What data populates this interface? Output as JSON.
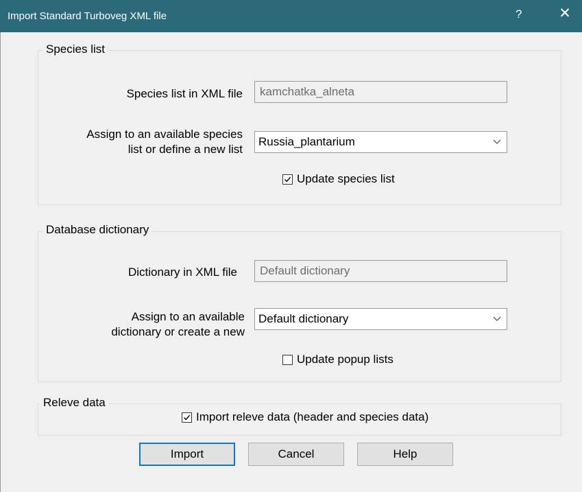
{
  "window": {
    "title": "Import Standard Turboveg XML file",
    "help_label": "?",
    "close_label": "✕"
  },
  "species": {
    "group_label": "Species list",
    "xml_label": "Species list in XML file",
    "xml_value": "kamchatka_alneta",
    "assign_label_line1": "Assign to an available species",
    "assign_label_line2": "list or define a new list",
    "assign_value": "Russia_plantarium",
    "update_label": "Update species list",
    "update_checked": true
  },
  "dictionary": {
    "group_label": "Database dictionary",
    "xml_label": "Dictionary in XML file",
    "xml_value": "Default dictionary",
    "assign_label_line1": "Assign to an available",
    "assign_label_line2": "dictionary or create a new",
    "assign_value": "Default dictionary",
    "update_label": "Update popup lists",
    "update_checked": false
  },
  "releve": {
    "group_label": "Releve data",
    "import_label": "Import releve data (header and species data)",
    "import_checked": true
  },
  "buttons": {
    "import_label": "Import",
    "cancel_label": "Cancel",
    "help_label": "Help"
  }
}
